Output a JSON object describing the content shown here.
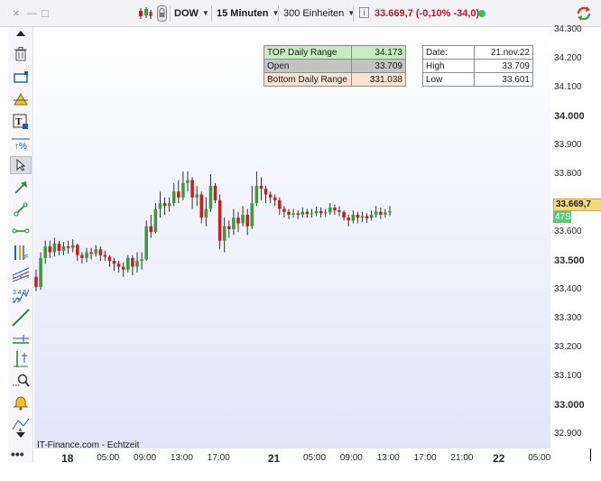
{
  "toolbar": {
    "window_close": "×",
    "window_minimize": "—",
    "window_maximize": "□",
    "symbol": "DOW",
    "interval": "15 Minuten",
    "units": "300 Einheiten",
    "quote": "33.669,7 (-0,10% -34,0)",
    "quote_color": "#c8102e",
    "live_dot_color": "#3fbf4f",
    "icons": [
      "candlestick-chart-icon",
      "lock-icon",
      "info-icon",
      "refresh-icon"
    ]
  },
  "tools": {
    "icons": [
      "scroll-icon",
      "trash-icon",
      "rectangle-icon",
      "alarm-draw-icon",
      "text-tool-icon",
      "percent-tool-icon",
      "pointer-icon",
      "arrow-line-icon",
      "line-segment-icon",
      "horizontal-line-icon",
      "fibonacci-icon",
      "trend-channel-icon",
      "elliott-wave-icon",
      "diagonal-line-icon",
      "horizontal-ray-icon",
      "vertical-line-icon",
      "zoom-icon",
      "alert-bell-icon",
      "pitchfork-icon",
      "scroll-down-icon"
    ],
    "more": "•••"
  },
  "range_table": {
    "rows": [
      {
        "label": "TOP Daily Range",
        "value": "34.173"
      },
      {
        "label": "Open",
        "value": "33.709"
      },
      {
        "label": "Bottom Daily Range",
        "value": "331.038"
      }
    ]
  },
  "day_table": {
    "rows": [
      {
        "label": "Date:",
        "value": "21.nov.22"
      },
      {
        "label": "High",
        "value": "33.709"
      },
      {
        "label": "Low",
        "value": "33.601"
      }
    ]
  },
  "price_tag": "33.669,7",
  "countdown": "47S",
  "source": "IT-Finance.com - Echtzeit",
  "colors": {
    "up": "#3c9a3c",
    "down": "#c81e1e",
    "wick": "#1b1b1b"
  },
  "chart_data": {
    "type": "candlestick",
    "title": "",
    "symbol": "DOW",
    "interval": "15 Minuten",
    "y_ticks": [
      "34.300",
      "34.200",
      "34.100",
      "34.000",
      "33.900",
      "33.800",
      "33.700",
      "33.600",
      "33.500",
      "33.400",
      "33.300",
      "33.200",
      "33.100",
      "33.000",
      "32.900"
    ],
    "ylim": [
      32850,
      34310
    ],
    "x_ticks": [
      "18",
      "05:00",
      "09:00",
      "13:00",
      "17:00",
      "21",
      "05:00",
      "09:00",
      "13:00",
      "17:00",
      "21:00",
      "22",
      "05:00"
    ],
    "x_ticks_bold": [
      "18",
      "21",
      "22"
    ],
    "xlim": [
      0,
      140
    ],
    "x_tick_positions": [
      9,
      20,
      30,
      40,
      50,
      65,
      76,
      86,
      96,
      106,
      116,
      126,
      137
    ],
    "candles": [
      [
        33445,
        33410,
        33470,
        33395
      ],
      [
        33410,
        33510,
        33530,
        33400
      ],
      [
        33510,
        33550,
        33570,
        33490
      ],
      [
        33550,
        33530,
        33570,
        33510
      ],
      [
        33530,
        33560,
        33580,
        33515
      ],
      [
        33560,
        33535,
        33570,
        33520
      ],
      [
        33535,
        33550,
        33565,
        33520
      ],
      [
        33550,
        33545,
        33570,
        33525
      ],
      [
        33545,
        33555,
        33575,
        33530
      ],
      [
        33555,
        33520,
        33560,
        33500
      ],
      [
        33520,
        33510,
        33530,
        33490
      ],
      [
        33510,
        33530,
        33545,
        33495
      ],
      [
        33530,
        33525,
        33545,
        33505
      ],
      [
        33525,
        33540,
        33555,
        33515
      ],
      [
        33540,
        33520,
        33550,
        33500
      ],
      [
        33520,
        33515,
        33535,
        33500
      ],
      [
        33515,
        33500,
        33520,
        33480
      ],
      [
        33500,
        33490,
        33510,
        33465
      ],
      [
        33490,
        33480,
        33500,
        33460
      ],
      [
        33480,
        33470,
        33495,
        33445
      ],
      [
        33470,
        33510,
        33520,
        33460
      ],
      [
        33510,
        33480,
        33520,
        33450
      ],
      [
        33480,
        33500,
        33530,
        33460
      ],
      [
        33500,
        33505,
        33530,
        33470
      ],
      [
        33505,
        33620,
        33640,
        33500
      ],
      [
        33620,
        33600,
        33660,
        33580
      ],
      [
        33600,
        33680,
        33700,
        33595
      ],
      [
        33680,
        33700,
        33740,
        33650
      ],
      [
        33700,
        33690,
        33720,
        33660
      ],
      [
        33690,
        33700,
        33720,
        33670
      ],
      [
        33700,
        33740,
        33770,
        33690
      ],
      [
        33740,
        33720,
        33780,
        33700
      ],
      [
        33720,
        33770,
        33810,
        33710
      ],
      [
        33770,
        33780,
        33810,
        33740
      ],
      [
        33780,
        33720,
        33790,
        33680
      ],
      [
        33720,
        33730,
        33760,
        33690
      ],
      [
        33730,
        33650,
        33740,
        33630
      ],
      [
        33650,
        33680,
        33720,
        33620
      ],
      [
        33680,
        33760,
        33800,
        33670
      ],
      [
        33760,
        33710,
        33770,
        33700
      ],
      [
        33710,
        33570,
        33730,
        33540
      ],
      [
        33570,
        33620,
        33650,
        33530
      ],
      [
        33620,
        33610,
        33640,
        33580
      ],
      [
        33610,
        33650,
        33680,
        33590
      ],
      [
        33650,
        33630,
        33670,
        33600
      ],
      [
        33630,
        33660,
        33690,
        33620
      ],
      [
        33660,
        33620,
        33680,
        33590
      ],
      [
        33620,
        33700,
        33760,
        33610
      ],
      [
        33700,
        33760,
        33810,
        33690
      ],
      [
        33760,
        33750,
        33790,
        33710
      ],
      [
        33750,
        33730,
        33760,
        33700
      ],
      [
        33730,
        33720,
        33740,
        33700
      ],
      [
        33720,
        33710,
        33730,
        33690
      ],
      [
        33710,
        33680,
        33720,
        33660
      ],
      [
        33680,
        33670,
        33690,
        33650
      ],
      [
        33670,
        33660,
        33680,
        33645
      ],
      [
        33660,
        33665,
        33680,
        33650
      ],
      [
        33665,
        33660,
        33675,
        33645
      ],
      [
        33660,
        33670,
        33685,
        33650
      ],
      [
        33670,
        33662,
        33680,
        33650
      ],
      [
        33662,
        33665,
        33680,
        33650
      ],
      [
        33665,
        33672,
        33688,
        33655
      ],
      [
        33672,
        33665,
        33685,
        33650
      ],
      [
        33665,
        33668,
        33680,
        33652
      ],
      [
        33668,
        33685,
        33700,
        33660
      ],
      [
        33685,
        33675,
        33695,
        33660
      ],
      [
        33675,
        33670,
        33690,
        33655
      ],
      [
        33670,
        33650,
        33675,
        33640
      ],
      [
        33650,
        33640,
        33660,
        33620
      ],
      [
        33640,
        33660,
        33675,
        33630
      ],
      [
        33660,
        33650,
        33670,
        33630
      ],
      [
        33650,
        33655,
        33670,
        33635
      ],
      [
        33655,
        33648,
        33665,
        33632
      ],
      [
        33648,
        33660,
        33675,
        33640
      ],
      [
        33660,
        33670,
        33690,
        33650
      ],
      [
        33670,
        33660,
        33685,
        33645
      ],
      [
        33660,
        33668,
        33680,
        33650
      ],
      [
        33668,
        33672,
        33690,
        33655
      ]
    ]
  }
}
